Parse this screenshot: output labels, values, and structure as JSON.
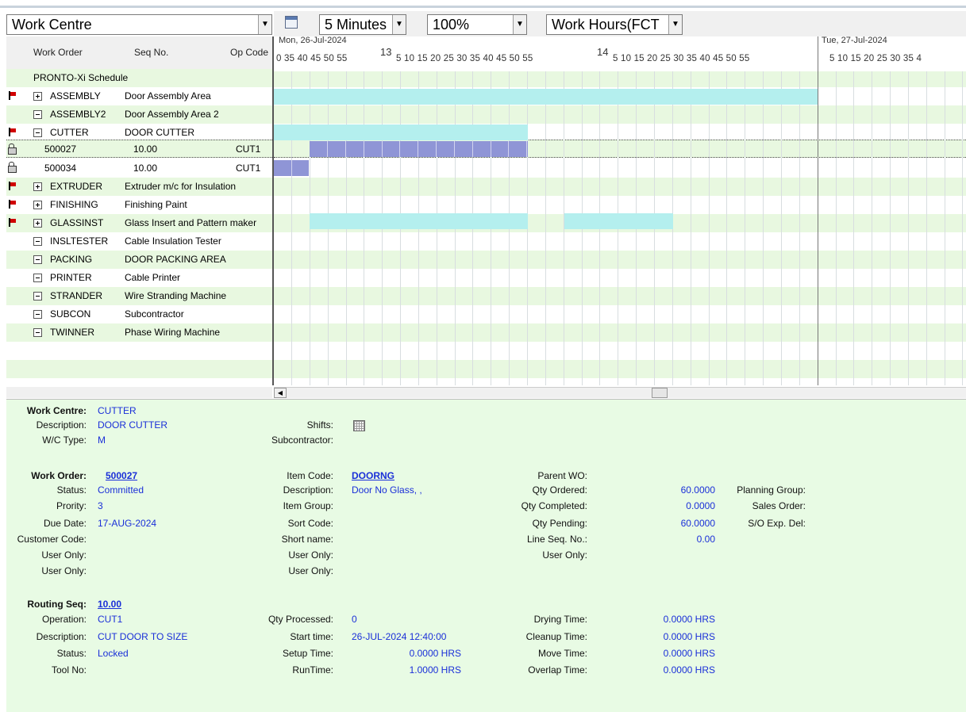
{
  "toolbar": {
    "work_centre_combo": "Work Centre",
    "interval_combo": "5 Minutes",
    "zoom_combo": "100%",
    "hours_combo": "Work Hours(FCT"
  },
  "grid_header": {
    "work_order": "Work Order",
    "seq_no": "Seq No.",
    "op_code": "Op Code"
  },
  "timeline": {
    "day1": "Mon, 26-Jul-2024",
    "day2": "Tue, 27-Jul-2024",
    "hour13": "13",
    "hour14": "14",
    "ticks_day1": "0  35  40  45  50  55",
    "ticks_h13": "5   10  15  20  25  30  35  40  45  50  55",
    "ticks_h14": "5   10  15  20  25  30  35  40  45  50  55",
    "ticks_day2": "5   10  15  20  25  30  35  4"
  },
  "rows": [
    {
      "name": "PRONTO-Xi Schedule",
      "desc": ""
    },
    {
      "name": "ASSEMBLY",
      "desc": "Door Assembly Area"
    },
    {
      "name": "ASSEMBLY2",
      "desc": "Door Assembly Area 2"
    },
    {
      "name": "CUTTER",
      "desc": "DOOR CUTTER"
    },
    {
      "name": "500027",
      "desc": "10.00",
      "op": "CUT1"
    },
    {
      "name": "500034",
      "desc": "10.00",
      "op": "CUT1"
    },
    {
      "name": "EXTRUDER",
      "desc": "Extruder m/c for Insulation"
    },
    {
      "name": "FINISHING",
      "desc": "Finishing Paint"
    },
    {
      "name": "GLASSINST",
      "desc": "Glass Insert and Pattern maker"
    },
    {
      "name": "INSLTESTER",
      "desc": "Cable Insulation Tester"
    },
    {
      "name": "PACKING",
      "desc": "DOOR PACKING AREA"
    },
    {
      "name": "PRINTER",
      "desc": "Cable Printer"
    },
    {
      "name": "STRANDER",
      "desc": "Wire Stranding Machine"
    },
    {
      "name": "SUBCON",
      "desc": "Subcontractor"
    },
    {
      "name": "TWINNER",
      "desc": "Phase Wiring Machine"
    }
  ],
  "details": {
    "wc": {
      "work_centre_label": "Work Centre:",
      "work_centre": "CUTTER",
      "description_label": "Description:",
      "description": "DOOR CUTTER",
      "type_label": "W/C Type:",
      "type": "M",
      "shifts_label": "Shifts:",
      "subcontractor_label": "Subcontractor:"
    },
    "wo": {
      "work_order_label": "Work Order:",
      "work_order": "500027",
      "status_label": "Status:",
      "status": "Committed",
      "priority_label": "Prority:",
      "priority": "3",
      "due_label": "Due Date:",
      "due": "17-AUG-2024",
      "customer_label": "Customer Code:",
      "user1_label": "User Only:",
      "user2_label": "User Only:",
      "item_code_label": "Item Code:",
      "item_code": "DOORNG",
      "item_desc_label": "Description:",
      "item_desc": "Door No Glass, ,",
      "item_group_label": "Item Group:",
      "sort_label": "Sort Code:",
      "short_label": "Short name:",
      "user3_label": "User Only:",
      "user4_label": "User Only:",
      "parent_label": "Parent WO:",
      "qty_ordered_label": "Qty Ordered:",
      "qty_ordered": "60.0000",
      "qty_completed_label": "Qty Completed:",
      "qty_completed": "0.0000",
      "qty_pending_label": "Qty Pending:",
      "qty_pending": "60.0000",
      "line_seq_label": "Line Seq. No.:",
      "line_seq": "0.00",
      "user5_label": "User Only:",
      "planning_label": "Planning Group:",
      "sales_label": "Sales Order:",
      "so_exp_label": "S/O Exp. Del:"
    },
    "rs": {
      "routing_label": "Routing Seq:",
      "routing": "10.00",
      "operation_label": "Operation:",
      "operation": "CUT1",
      "description_label": "Description:",
      "description": "CUT DOOR TO SIZE",
      "status_label": "Status:",
      "status": "Locked",
      "tool_label": "Tool No:",
      "qty_processed_label": "Qty Processed:",
      "qty_processed": "0",
      "start_label": "Start time:",
      "start": "26-JUL-2024 12:40:00",
      "setup_label": "Setup Time:",
      "setup": "0.0000 HRS",
      "run_label": "RunTime:",
      "run": "1.0000 HRS",
      "drying_label": "Drying Time:",
      "drying": "0.0000 HRS",
      "cleanup_label": "Cleanup Time:",
      "cleanup": "0.0000 HRS",
      "move_label": "Move Time:",
      "move": "0.0000 HRS",
      "overlap_label": "Overlap Time:",
      "overlap": "0.0000 HRS"
    }
  }
}
